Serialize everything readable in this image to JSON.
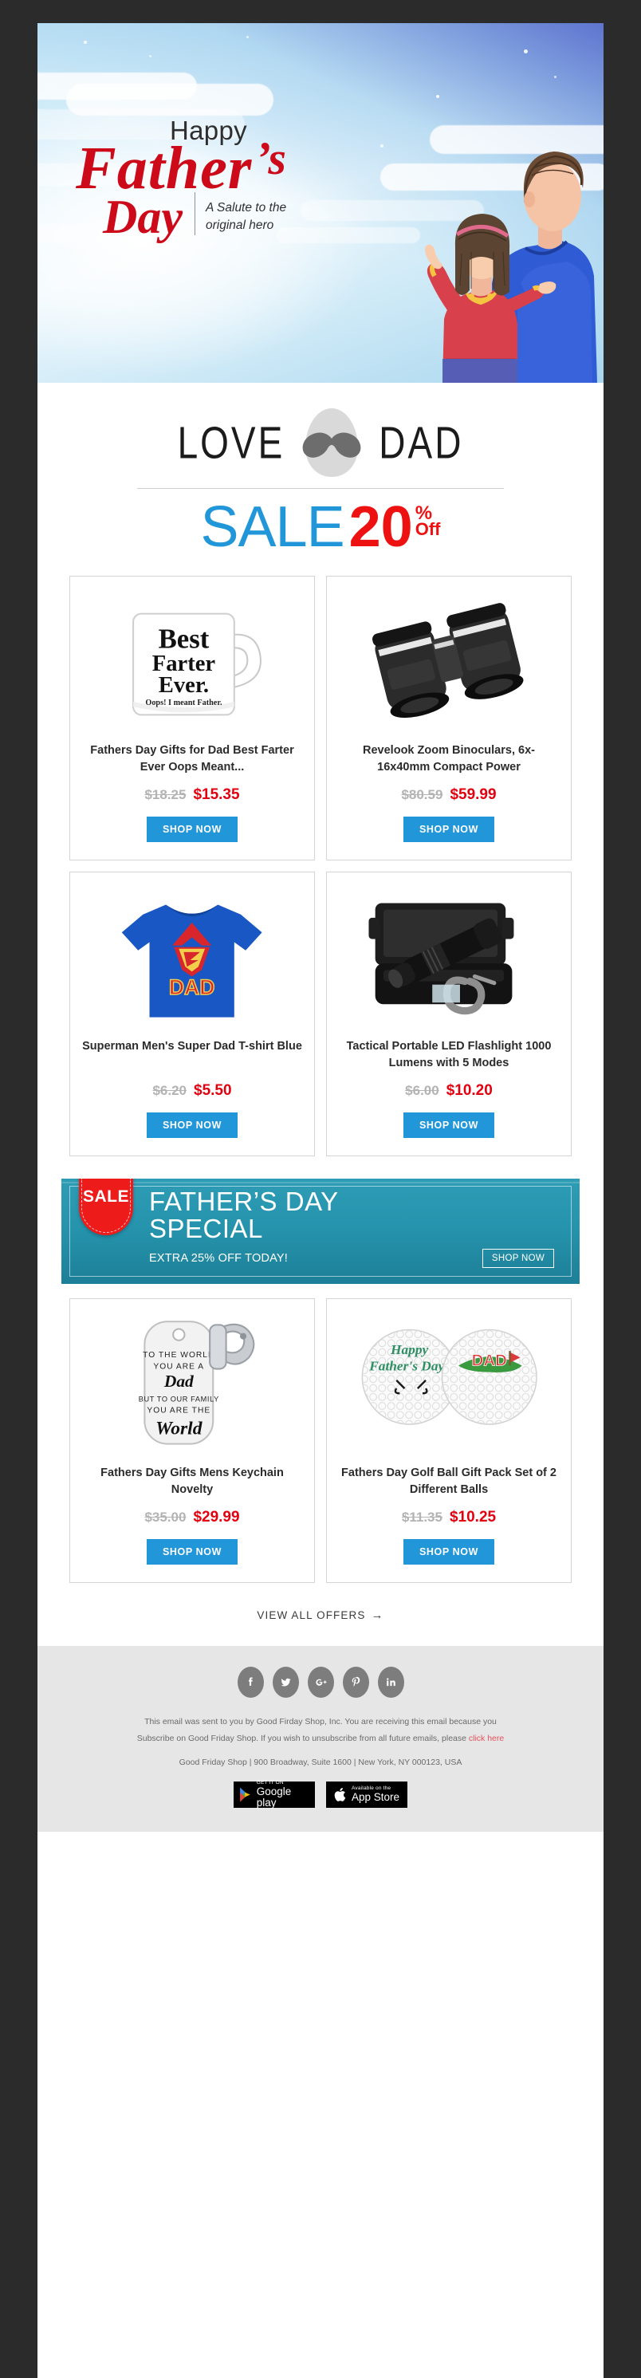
{
  "hero": {
    "happy": "Happy",
    "father": "Father",
    "apostrophe": "’s",
    "day": "Day",
    "subtitle_line1": "A Salute to the",
    "subtitle_line2": "original hero"
  },
  "headline": {
    "love": "LOVE",
    "dad": "DAD",
    "sale_word": "SALE",
    "sale_number": "20",
    "sale_percent": "%",
    "sale_off": "Off"
  },
  "products": [
    {
      "title": "Fathers Day Gifts for Dad Best Farter Ever Oops Meant...",
      "old_price": "$18.25",
      "new_price": "$15.35",
      "button": "SHOP NOW",
      "image": "coffee-mug",
      "mug_line1": "Best",
      "mug_line2": "Farter",
      "mug_line3": "Ever.",
      "mug_line4": "Oops! I meant Father."
    },
    {
      "title": "Revelook Zoom Binoculars, 6x-16x40mm Compact Power",
      "old_price": "$80.59",
      "new_price": "$59.99",
      "button": "SHOP NOW",
      "image": "binoculars"
    },
    {
      "title": "Superman Men's Super Dad T-shirt Blue",
      "old_price": "$6.20",
      "new_price": "$5.50",
      "button": "SHOP NOW",
      "image": "tshirt",
      "shirt_text": "DAD",
      "shirt_logo": "S"
    },
    {
      "title": "Tactical Portable LED Flashlight 1000 Lumens with 5 Modes",
      "old_price": "$6.00",
      "new_price": "$10.20",
      "button": "SHOP NOW",
      "image": "flashlight"
    },
    {
      "title": "Fathers Day Gifts Mens Keychain Novelty",
      "old_price": "$35.00",
      "new_price": "$29.99",
      "button": "SHOP NOW",
      "image": "keychain",
      "tag_l1": "TO THE WORLD",
      "tag_l2": "YOU ARE A",
      "tag_l3": "Dad",
      "tag_l4": "BUT TO OUR FAMILY",
      "tag_l5": "YOU ARE THE",
      "tag_l6": "World"
    },
    {
      "title": "Fathers Day Golf Ball Gift Pack Set of 2 Different Balls",
      "old_price": "$11.35",
      "new_price": "$10.25",
      "button": "SHOP NOW",
      "image": "golf-balls",
      "ball1_l1": "Happy",
      "ball1_l2": "Father's Day!",
      "ball2_text": "DAD"
    }
  ],
  "promo": {
    "tag": "SALE",
    "line1": "FATHER’S DAY",
    "line2": "SPECIAL",
    "extra": "EXTRA 25% OFF TODAY!",
    "button": "SHOP NOW"
  },
  "view_all": {
    "label": "VIEW ALL OFFERS",
    "arrow": "→"
  },
  "footer": {
    "socials": [
      "facebook-icon",
      "twitter-icon",
      "google-plus-icon",
      "pinterest-icon",
      "linkedin-icon"
    ],
    "legal_line1": "This email was sent to you by Good Firday Shop, Inc. You are receiving this email because you",
    "legal_line2_pre": "Subscribe on Good Friday Shop. If you wish to unsubscribe from all future emails, please ",
    "legal_link": "click here",
    "address": "Good Friday Shop | 900 Broadway, Suite 1600 | New York, NY 000123, USA",
    "google_play_small": "GET IT ON",
    "google_play_large": "Google play",
    "app_store_small": "Available on the",
    "app_store_large": "App Store"
  },
  "colors": {
    "accent_blue": "#2196d9",
    "sale_red": "#ee1111",
    "price_red": "#e3000f",
    "hero_red": "#cc0a19",
    "promo_teal": "#2694ad",
    "footer_bg": "#e6e6e6",
    "page_bg": "#2b2b2b"
  }
}
